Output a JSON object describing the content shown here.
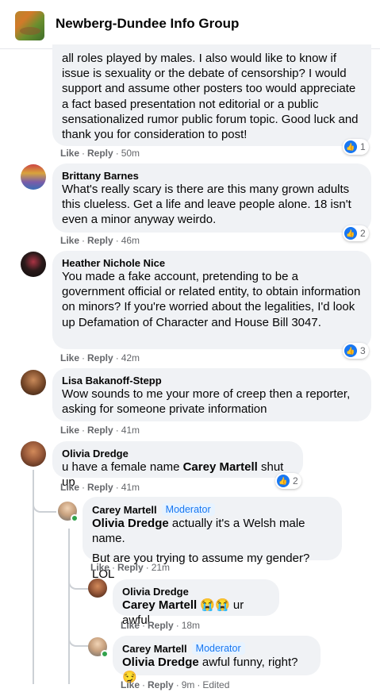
{
  "header": {
    "title": "Newberg-Dundee Info Group",
    "thumb_icon": "group-cover-image"
  },
  "actions": {
    "like": "Like",
    "reply": "Reply",
    "dot": "·"
  },
  "comments": [
    {
      "text": "all roles played by males. I also would like to know if issue is sexuality or the debate of censorship? I would support and assume other posters too would appreciate a fact based presentation not editorial or a public sensationalized rumor public forum topic. Good luck and thank you for consideration to post!",
      "time": "50m",
      "reactions": "1"
    },
    {
      "author": "Brittany Barnes",
      "text": "What's really scary is there are this many grown adults this clueless. Get a life and leave people alone. 18 isn't even a minor anyway weirdo.",
      "time": "46m",
      "reactions": "2"
    },
    {
      "author": "Heather Nichole Nice",
      "text": "You made a fake account, pretending to be a government official or related entity, to obtain information on minors? If you're worried about the legalities, I'd look up Defamation of Character and House Bill 3047.",
      "time": "42m",
      "reactions": "3"
    },
    {
      "author": "Lisa Bakanoff-Stepp",
      "text": "Wow sounds to me your more of creep then a reporter, asking for someone private information",
      "time": "41m"
    },
    {
      "author": "Olivia Dredge",
      "text_before": "u have a female name ",
      "mention": "Carey Martell",
      "text_after": " shut up",
      "time": "41m",
      "reactions": "2"
    }
  ],
  "replies": [
    {
      "author": "Carey Martell",
      "badge": "Moderator",
      "mention": "Olivia Dredge",
      "text_after": " actually it's a Welsh male name.",
      "text2": "But are you trying to assume my gender? LOL",
      "time": "21m"
    },
    {
      "author": "Olivia Dredge",
      "mention": "Carey Martell",
      "text_after": " 😭😭 ur awful",
      "time": "18m"
    },
    {
      "author": "Carey Martell",
      "badge": "Moderator",
      "mention": "Olivia Dredge",
      "text_after": " awful funny, right? 😏",
      "time": "9m",
      "edited": "Edited"
    }
  ],
  "colors": {
    "bubble": "#f0f2f5",
    "like_blue": "#1877f2",
    "meta_gray": "#65676b",
    "moderator_bg": "#e7f3ff"
  }
}
